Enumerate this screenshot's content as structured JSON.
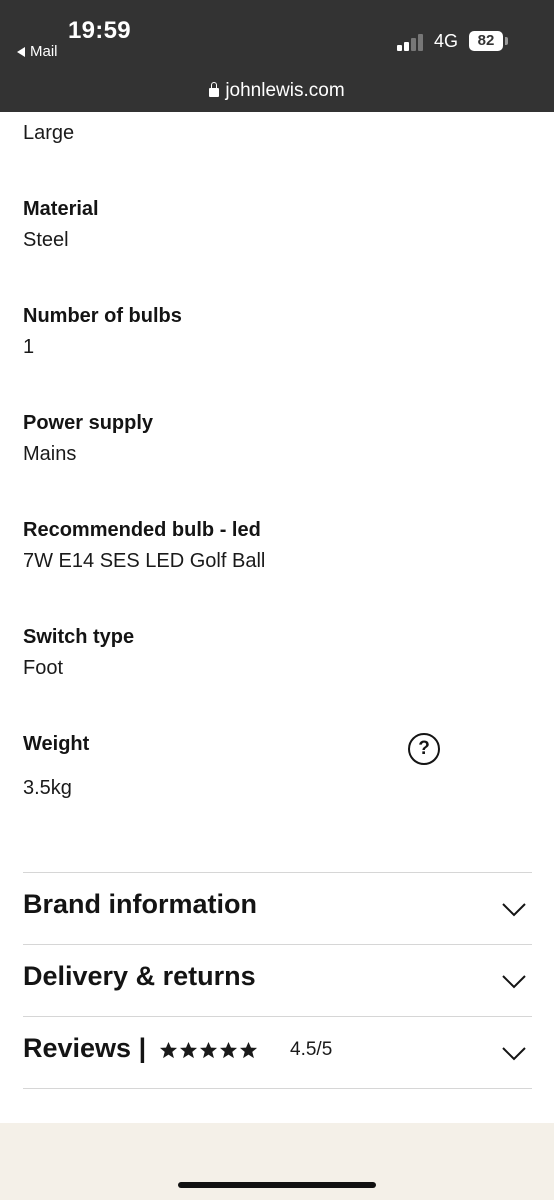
{
  "status_bar": {
    "time": "19:59",
    "back_label": "Mail",
    "network": "4G",
    "battery": "82",
    "url": "johnlewis.com"
  },
  "specs": {
    "size_value": "Large",
    "items": [
      {
        "label": "Material",
        "value": "Steel"
      },
      {
        "label": "Number of bulbs",
        "value": "1"
      },
      {
        "label": "Power supply",
        "value": "Mains"
      },
      {
        "label": "Recommended bulb - led",
        "value": "7W E14 SES LED Golf Ball"
      },
      {
        "label": "Switch type",
        "value": "Foot"
      },
      {
        "label": "Weight",
        "value": "3.5kg"
      }
    ],
    "help_icon": "question-circle-icon"
  },
  "accordion": {
    "brand_label": "Brand information",
    "delivery_label": "Delivery & returns",
    "reviews_label": "Reviews |",
    "rating_text": "4.5/5",
    "rating_value": 4.5,
    "rating_max": 5
  },
  "colors": {
    "status_bar_bg": "#333333",
    "text": "#141414",
    "divider": "#d6d6d6",
    "footer_band": "#f4f0e8"
  }
}
